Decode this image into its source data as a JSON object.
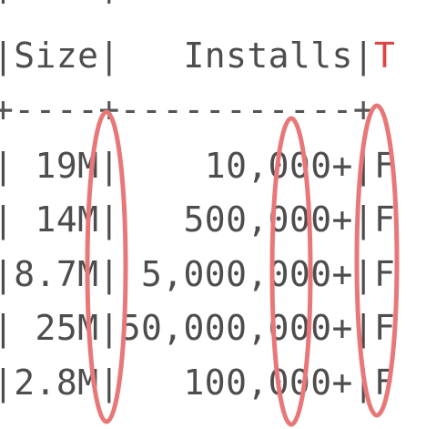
{
  "table": {
    "top_line": "+----+----------",
    "header": {
      "size": "Size",
      "installs": "Installs",
      "next_col_initial": "T"
    },
    "separator": "+----+-----------+",
    "rows": [
      {
        "size": " 19M",
        "installs": "    10,000+",
        "next": "F"
      },
      {
        "size": " 14M",
        "installs": "   500,000+",
        "next": "F"
      },
      {
        "size": "8.7M",
        "installs": " 5,000,000+",
        "next": "F"
      },
      {
        "size": " 25M",
        "installs": "50,000,000+",
        "next": "F"
      },
      {
        "size": "2.8M",
        "installs": "   100,000+",
        "next": "F"
      }
    ]
  },
  "annotations": {
    "color": "#e87878"
  }
}
